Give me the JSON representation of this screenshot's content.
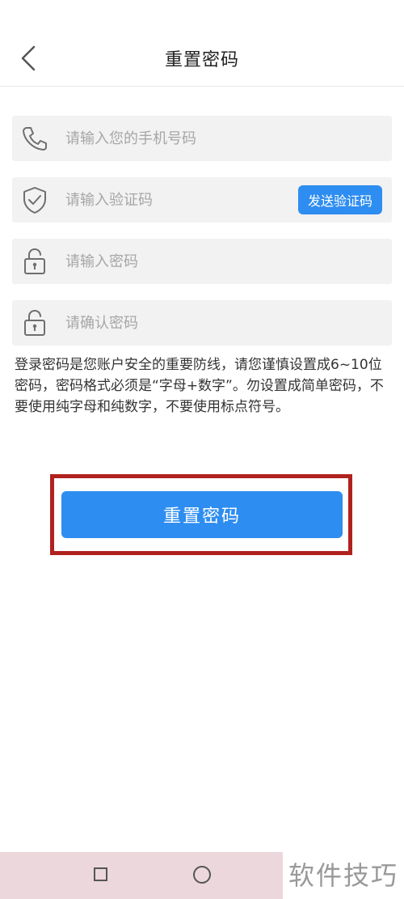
{
  "header": {
    "back_icon": "chevron-left-icon",
    "title": "重置密码"
  },
  "form": {
    "phone": {
      "icon": "phone-icon",
      "placeholder": "请输入您的手机号码",
      "value": ""
    },
    "code": {
      "icon": "shield-check-icon",
      "placeholder": "请输入验证码",
      "value": "",
      "send_button_label": "发送验证码"
    },
    "password": {
      "icon": "lock-icon",
      "placeholder": "请输入密码",
      "value": ""
    },
    "confirm_password": {
      "icon": "lock-icon",
      "placeholder": "请确认密码",
      "value": ""
    },
    "notice": "登录密码是您账户安全的重要防线，请您谨慎设置成6~10位密码，密码格式必须是“字母+数字”。勿设置成简单密码，不要使用纯字母和纯数字，不要使用标点符号。",
    "submit_label": "重置密码"
  },
  "colors": {
    "primary": "#2e8df0",
    "highlight": "#b0221e",
    "field_bg": "#f2f2f2",
    "navbar_bg": "#ecd7dc"
  },
  "navbar": {
    "recent_icon": "square-icon",
    "home_icon": "circle-icon"
  },
  "watermark": "软件技巧"
}
